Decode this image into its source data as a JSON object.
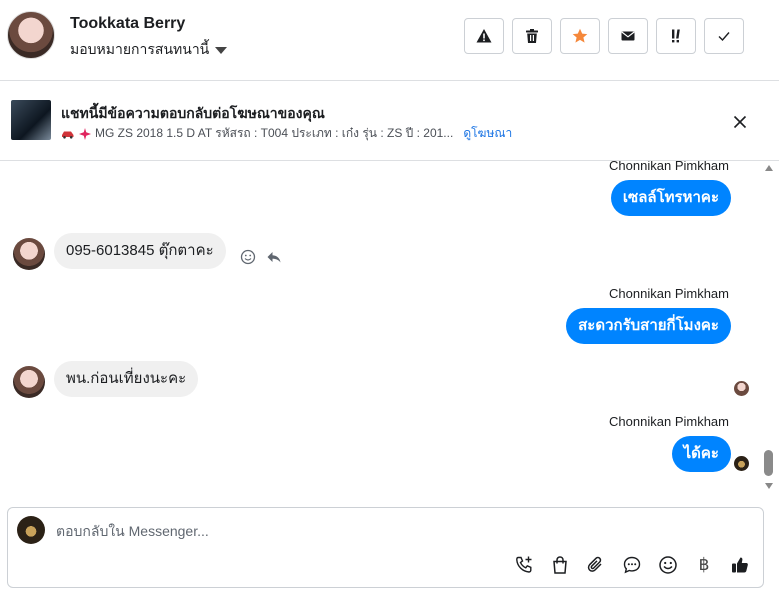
{
  "header": {
    "contact_name": "Tookkata Berry",
    "assign_label": "มอบหมายการสนทนานี้",
    "buttons": [
      {
        "name": "report-spam-button",
        "icon": "warning-icon"
      },
      {
        "name": "delete-button",
        "icon": "trash-icon"
      },
      {
        "name": "star-button",
        "icon": "star-icon"
      },
      {
        "name": "mark-unread-button",
        "icon": "envelope-icon"
      },
      {
        "name": "follow-up-button",
        "icon": "exclamation-icon"
      },
      {
        "name": "mark-done-button",
        "icon": "check-icon"
      }
    ]
  },
  "ad_banner": {
    "title": "แชทนี้มีข้อความตอบกลับต่อโฆษณาของคุณ",
    "description": "MG ZS 2018 1.5 D AT รหัสรถ : T004 ประเภท : เก๋ง รุ่น : ZS ปี : 201...",
    "link_label": "ดูโฆษณา"
  },
  "messages": [
    {
      "direction": "out",
      "sender": "Chonnikan Pimkham",
      "text": "เซลล์โทรหาคะ"
    },
    {
      "direction": "in",
      "text": "095-6013845 ตุ๊กตาคะ"
    },
    {
      "direction": "out",
      "sender": "Chonnikan Pimkham",
      "text": "สะดวกรับสายกี่โมงคะ"
    },
    {
      "direction": "in",
      "text": "พน.ก่อนเที่ยงนะคะ"
    },
    {
      "direction": "out",
      "sender": "Chonnikan Pimkham",
      "text": "ได้คะ"
    }
  ],
  "composer": {
    "placeholder": "ตอบกลับใน Messenger...",
    "baht_symbol": "฿"
  },
  "colors": {
    "outgoing_bubble": "#0084ff",
    "incoming_bubble": "#f0f0f0",
    "link": "#1b74e4",
    "star": "#f5883b"
  }
}
